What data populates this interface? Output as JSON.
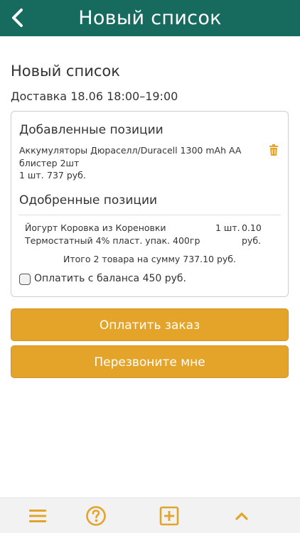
{
  "header": {
    "title": "Новый список",
    "back_icon": "chevron-left-icon"
  },
  "page": {
    "title": "Новый список",
    "delivery": "Доставка 18.06 18:00–19:00"
  },
  "added": {
    "title": "Добавленные позиции",
    "items": [
      {
        "name": "Аккумуляторы Дюраселл/Duracell 1300 mAh AA блистер 2шт",
        "qty": "1 шт.",
        "price": "737 руб.",
        "delete_icon": "trash-icon"
      }
    ]
  },
  "approved": {
    "title": "Одобренные позиции",
    "items": [
      {
        "name": "Йогурт Коровка из Кореновки Термостатный 4% пласт. упак. 400гр",
        "qty": "1 шт.",
        "price": "0.10 руб."
      }
    ],
    "total": "Итого 2 товара на сумму 737.10 руб."
  },
  "balance": {
    "label": "Оплатить с баланса 450 руб.",
    "checked": false
  },
  "buttons": {
    "pay": "Оплатить заказ",
    "callback": "Перезвоните мне"
  },
  "bottom_nav": {
    "icons": [
      "menu-icon",
      "help-icon",
      "add-icon",
      "chevron-up-icon"
    ]
  },
  "colors": {
    "header_bg": "#166a5e",
    "accent": "#e4a42a",
    "bottom_bar_bg": "#f2f2f2"
  }
}
